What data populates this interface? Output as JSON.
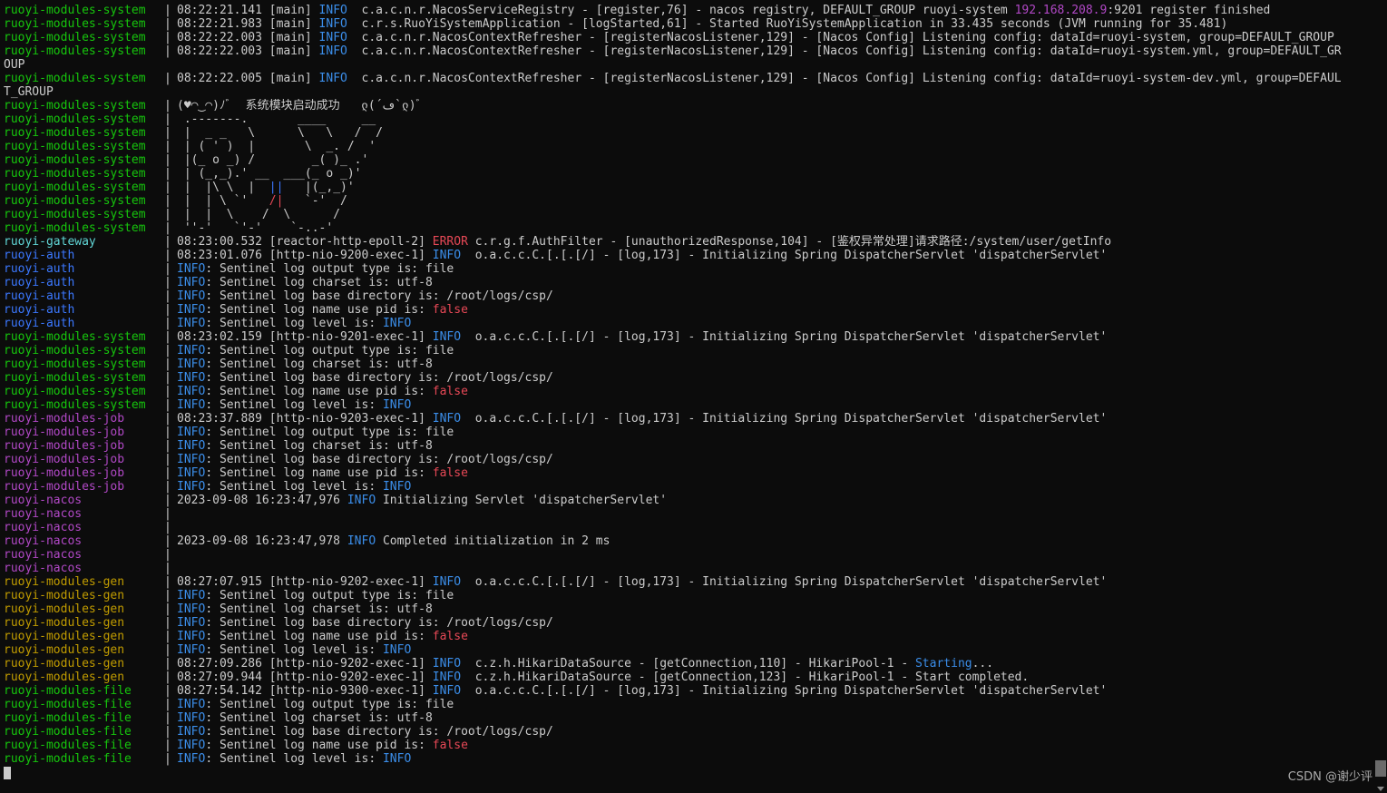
{
  "colors": {
    "background": "#0c0c0c",
    "foreground": "#cccccc",
    "info": "#3b8eea",
    "error": "#e74856",
    "system": "#16c60c",
    "gateway": "#61d6d6",
    "auth": "#3b78ff",
    "job": "#b148c6",
    "gen": "#c19c00",
    "file": "#16c60c"
  },
  "terminal": {
    "lines": [
      {
        "svc": "ruoyi-modules-system",
        "c": "c-system",
        "sep": "|",
        "segs": [
          {
            "t": "08:22:21.141 [main] "
          },
          {
            "t": "INFO",
            "c": "c-info"
          },
          {
            "t": "  c.a.c.n.r.NacosServiceRegistry - [register,76] - nacos registry, DEFAULT_GROUP ruoyi-system "
          },
          {
            "t": "192.168.208.9",
            "c": "c-ip"
          },
          {
            "t": ":9201 register finished"
          }
        ]
      },
      {
        "svc": "ruoyi-modules-system",
        "c": "c-system",
        "sep": "|",
        "segs": [
          {
            "t": "08:22:21.983 [main] "
          },
          {
            "t": "INFO",
            "c": "c-info"
          },
          {
            "t": "  c.r.s.RuoYiSystemApplication - [logStarted,61] - Started RuoYiSystemApplication in 33.435 seconds (JVM running for 35.481)"
          }
        ]
      },
      {
        "svc": "ruoyi-modules-system",
        "c": "c-system",
        "sep": "|",
        "segs": [
          {
            "t": "08:22:22.003 [main] "
          },
          {
            "t": "INFO",
            "c": "c-info"
          },
          {
            "t": "  c.a.c.n.r.NacosContextRefresher - [registerNacosListener,129] - [Nacos Config] Listening config: dataId=ruoyi-system, group=DEFAULT_GROUP"
          }
        ]
      },
      {
        "svc": "ruoyi-modules-system",
        "c": "c-system",
        "sep": "|",
        "segs": [
          {
            "t": "08:22:22.003 [main] "
          },
          {
            "t": "INFO",
            "c": "c-info"
          },
          {
            "t": "  c.a.c.n.r.NacosContextRefresher - [registerNacosListener,129] - [Nacos Config] Listening config: dataId=ruoyi-system.yml, group=DEFAULT_GR"
          }
        ]
      },
      {
        "svc": "",
        "c": "",
        "sep": "",
        "segs": [
          {
            "t": "OUP"
          }
        ]
      },
      {
        "svc": "ruoyi-modules-system",
        "c": "c-system",
        "sep": "|",
        "segs": [
          {
            "t": "08:22:22.005 [main] "
          },
          {
            "t": "INFO",
            "c": "c-info"
          },
          {
            "t": "  c.a.c.n.r.NacosContextRefresher - [registerNacosListener,129] - [Nacos Config] Listening config: dataId=ruoyi-system-dev.yml, group=DEFAUL"
          }
        ]
      },
      {
        "svc": "",
        "c": "",
        "sep": "",
        "segs": [
          {
            "t": "T_GROUP"
          }
        ]
      },
      {
        "svc": "ruoyi-modules-system",
        "c": "c-system",
        "sep": "|",
        "segs": [
          {
            "t": "(♥◠‿◠)ﾉﾞ  系统模块启动成功   ლ(´ڡ`ლ)ﾞ"
          }
        ]
      },
      {
        "svc": "ruoyi-modules-system",
        "c": "c-system",
        "sep": "|",
        "segs": [
          {
            "t": " .-------.       ____     __"
          }
        ]
      },
      {
        "svc": "ruoyi-modules-system",
        "c": "c-system",
        "sep": "|",
        "segs": [
          {
            "t": " |  _ _   \\      \\   \\   /  /"
          }
        ]
      },
      {
        "svc": "ruoyi-modules-system",
        "c": "c-system",
        "sep": "|",
        "segs": [
          {
            "t": " | ( ' )  |       \\  _. /  '"
          }
        ]
      },
      {
        "svc": "ruoyi-modules-system",
        "c": "c-system",
        "sep": "|",
        "segs": [
          {
            "t": " |(_ o _) /        _( )_ .'"
          }
        ]
      },
      {
        "svc": "ruoyi-modules-system",
        "c": "c-system",
        "sep": "|",
        "segs": [
          {
            "t": " | (_,_).' __  ___(_ o _)'"
          }
        ]
      },
      {
        "svc": "ruoyi-modules-system",
        "c": "c-system",
        "sep": "|",
        "segs": [
          {
            "t": " |  |\\ \\  |  "
          },
          {
            "t": "||",
            "c": "c-ascii-blue"
          },
          {
            "t": "   |(_,_)'"
          }
        ]
      },
      {
        "svc": "ruoyi-modules-system",
        "c": "c-system",
        "sep": "|",
        "segs": [
          {
            "t": " |  | \\ `'   "
          },
          {
            "t": "/|",
            "c": "c-ascii-red"
          },
          {
            "t": "   `-'  /"
          }
        ]
      },
      {
        "svc": "ruoyi-modules-system",
        "c": "c-system",
        "sep": "|",
        "segs": [
          {
            "t": " |  |  \\    /  \\      /"
          }
        ]
      },
      {
        "svc": "ruoyi-modules-system",
        "c": "c-system",
        "sep": "|",
        "segs": [
          {
            "t": " ''-'   `'-'    `-..-'"
          }
        ]
      },
      {
        "svc": "ruoyi-gateway",
        "c": "c-gateway",
        "sep": "|",
        "segs": [
          {
            "t": "08:23:00.532 [reactor-http-epoll-2] "
          },
          {
            "t": "ERROR",
            "c": "c-error"
          },
          {
            "t": " c.r.g.f.AuthFilter - [unauthorizedResponse,104] - [鉴权异常处理]请求路径:/system/user/getInfo"
          }
        ]
      },
      {
        "svc": "ruoyi-auth",
        "c": "c-auth",
        "sep": "|",
        "segs": [
          {
            "t": "08:23:01.076 [http-nio-9200-exec-1] "
          },
          {
            "t": "INFO",
            "c": "c-info"
          },
          {
            "t": "  o.a.c.c.C.[.[.[/] - [log,173] - Initializing Spring DispatcherServlet 'dispatcherServlet'"
          }
        ]
      },
      {
        "svc": "ruoyi-auth",
        "c": "c-auth",
        "sep": "|",
        "segs": [
          {
            "t": "INFO",
            "c": "c-info"
          },
          {
            "t": ": Sentinel log output type is: file"
          }
        ]
      },
      {
        "svc": "ruoyi-auth",
        "c": "c-auth",
        "sep": "|",
        "segs": [
          {
            "t": "INFO",
            "c": "c-info"
          },
          {
            "t": ": Sentinel log charset is: utf-8"
          }
        ]
      },
      {
        "svc": "ruoyi-auth",
        "c": "c-auth",
        "sep": "|",
        "segs": [
          {
            "t": "INFO",
            "c": "c-info"
          },
          {
            "t": ": Sentinel log base directory is: /root/logs/csp/"
          }
        ]
      },
      {
        "svc": "ruoyi-auth",
        "c": "c-auth",
        "sep": "|",
        "segs": [
          {
            "t": "INFO",
            "c": "c-info"
          },
          {
            "t": ": Sentinel log name use pid is: "
          },
          {
            "t": "false",
            "c": "c-false"
          }
        ]
      },
      {
        "svc": "ruoyi-auth",
        "c": "c-auth",
        "sep": "|",
        "segs": [
          {
            "t": "INFO",
            "c": "c-info"
          },
          {
            "t": ": Sentinel log level is: "
          },
          {
            "t": "INFO",
            "c": "c-info"
          }
        ]
      },
      {
        "svc": "ruoyi-modules-system",
        "c": "c-system",
        "sep": "|",
        "segs": [
          {
            "t": "08:23:02.159 [http-nio-9201-exec-1] "
          },
          {
            "t": "INFO",
            "c": "c-info"
          },
          {
            "t": "  o.a.c.c.C.[.[.[/] - [log,173] - Initializing Spring DispatcherServlet 'dispatcherServlet'"
          }
        ]
      },
      {
        "svc": "ruoyi-modules-system",
        "c": "c-system",
        "sep": "|",
        "segs": [
          {
            "t": "INFO",
            "c": "c-info"
          },
          {
            "t": ": Sentinel log output type is: file"
          }
        ]
      },
      {
        "svc": "ruoyi-modules-system",
        "c": "c-system",
        "sep": "|",
        "segs": [
          {
            "t": "INFO",
            "c": "c-info"
          },
          {
            "t": ": Sentinel log charset is: utf-8"
          }
        ]
      },
      {
        "svc": "ruoyi-modules-system",
        "c": "c-system",
        "sep": "|",
        "segs": [
          {
            "t": "INFO",
            "c": "c-info"
          },
          {
            "t": ": Sentinel log base directory is: /root/logs/csp/"
          }
        ]
      },
      {
        "svc": "ruoyi-modules-system",
        "c": "c-system",
        "sep": "|",
        "segs": [
          {
            "t": "INFO",
            "c": "c-info"
          },
          {
            "t": ": Sentinel log name use pid is: "
          },
          {
            "t": "false",
            "c": "c-false"
          }
        ]
      },
      {
        "svc": "ruoyi-modules-system",
        "c": "c-system",
        "sep": "|",
        "segs": [
          {
            "t": "INFO",
            "c": "c-info"
          },
          {
            "t": ": Sentinel log level is: "
          },
          {
            "t": "INFO",
            "c": "c-info"
          }
        ]
      },
      {
        "svc": "ruoyi-modules-job",
        "c": "c-job",
        "sep": "|",
        "segs": [
          {
            "t": "08:23:37.889 [http-nio-9203-exec-1] "
          },
          {
            "t": "INFO",
            "c": "c-info"
          },
          {
            "t": "  o.a.c.c.C.[.[.[/] - [log,173] - Initializing Spring DispatcherServlet 'dispatcherServlet'"
          }
        ]
      },
      {
        "svc": "ruoyi-modules-job",
        "c": "c-job",
        "sep": "|",
        "segs": [
          {
            "t": "INFO",
            "c": "c-info"
          },
          {
            "t": ": Sentinel log output type is: file"
          }
        ]
      },
      {
        "svc": "ruoyi-modules-job",
        "c": "c-job",
        "sep": "|",
        "segs": [
          {
            "t": "INFO",
            "c": "c-info"
          },
          {
            "t": ": Sentinel log charset is: utf-8"
          }
        ]
      },
      {
        "svc": "ruoyi-modules-job",
        "c": "c-job",
        "sep": "|",
        "segs": [
          {
            "t": "INFO",
            "c": "c-info"
          },
          {
            "t": ": Sentinel log base directory is: /root/logs/csp/"
          }
        ]
      },
      {
        "svc": "ruoyi-modules-job",
        "c": "c-job",
        "sep": "|",
        "segs": [
          {
            "t": "INFO",
            "c": "c-info"
          },
          {
            "t": ": Sentinel log name use pid is: "
          },
          {
            "t": "false",
            "c": "c-false"
          }
        ]
      },
      {
        "svc": "ruoyi-modules-job",
        "c": "c-job",
        "sep": "|",
        "segs": [
          {
            "t": "INFO",
            "c": "c-info"
          },
          {
            "t": ": Sentinel log level is: "
          },
          {
            "t": "INFO",
            "c": "c-info"
          }
        ]
      },
      {
        "svc": "ruoyi-nacos",
        "c": "c-nacos",
        "sep": "|",
        "segs": [
          {
            "t": "2023-09-08 16:23:47,976 "
          },
          {
            "t": "INFO",
            "c": "c-info"
          },
          {
            "t": " Initializing Servlet 'dispatcherServlet'"
          }
        ]
      },
      {
        "svc": "ruoyi-nacos",
        "c": "c-nacos",
        "sep": "|",
        "segs": []
      },
      {
        "svc": "ruoyi-nacos",
        "c": "c-nacos",
        "sep": "|",
        "segs": []
      },
      {
        "svc": "ruoyi-nacos",
        "c": "c-nacos",
        "sep": "|",
        "segs": [
          {
            "t": "2023-09-08 16:23:47,978 "
          },
          {
            "t": "INFO",
            "c": "c-info"
          },
          {
            "t": " Completed initialization in 2 ms"
          }
        ]
      },
      {
        "svc": "ruoyi-nacos",
        "c": "c-nacos",
        "sep": "|",
        "segs": []
      },
      {
        "svc": "ruoyi-nacos",
        "c": "c-nacos",
        "sep": "|",
        "segs": []
      },
      {
        "svc": "ruoyi-modules-gen",
        "c": "c-gen",
        "sep": "|",
        "segs": [
          {
            "t": "08:27:07.915 [http-nio-9202-exec-1] "
          },
          {
            "t": "INFO",
            "c": "c-info"
          },
          {
            "t": "  o.a.c.c.C.[.[.[/] - [log,173] - Initializing Spring DispatcherServlet 'dispatcherServlet'"
          }
        ]
      },
      {
        "svc": "ruoyi-modules-gen",
        "c": "c-gen",
        "sep": "|",
        "segs": [
          {
            "t": "INFO",
            "c": "c-info"
          },
          {
            "t": ": Sentinel log output type is: file"
          }
        ]
      },
      {
        "svc": "ruoyi-modules-gen",
        "c": "c-gen",
        "sep": "|",
        "segs": [
          {
            "t": "INFO",
            "c": "c-info"
          },
          {
            "t": ": Sentinel log charset is: utf-8"
          }
        ]
      },
      {
        "svc": "ruoyi-modules-gen",
        "c": "c-gen",
        "sep": "|",
        "segs": [
          {
            "t": "INFO",
            "c": "c-info"
          },
          {
            "t": ": Sentinel log base directory is: /root/logs/csp/"
          }
        ]
      },
      {
        "svc": "ruoyi-modules-gen",
        "c": "c-gen",
        "sep": "|",
        "segs": [
          {
            "t": "INFO",
            "c": "c-info"
          },
          {
            "t": ": Sentinel log name use pid is: "
          },
          {
            "t": "false",
            "c": "c-false"
          }
        ]
      },
      {
        "svc": "ruoyi-modules-gen",
        "c": "c-gen",
        "sep": "|",
        "segs": [
          {
            "t": "INFO",
            "c": "c-info"
          },
          {
            "t": ": Sentinel log level is: "
          },
          {
            "t": "INFO",
            "c": "c-info"
          }
        ]
      },
      {
        "svc": "ruoyi-modules-gen",
        "c": "c-gen",
        "sep": "|",
        "segs": [
          {
            "t": "08:27:09.286 [http-nio-9202-exec-1] "
          },
          {
            "t": "INFO",
            "c": "c-info"
          },
          {
            "t": "  c.z.h.HikariDataSource - [getConnection,110] - HikariPool-1 - "
          },
          {
            "t": "Starting",
            "c": "c-starting"
          },
          {
            "t": "..."
          }
        ]
      },
      {
        "svc": "ruoyi-modules-gen",
        "c": "c-gen",
        "sep": "|",
        "segs": [
          {
            "t": "08:27:09.944 [http-nio-9202-exec-1] "
          },
          {
            "t": "INFO",
            "c": "c-info"
          },
          {
            "t": "  c.z.h.HikariDataSource - [getConnection,123] - HikariPool-1 - Start completed."
          }
        ]
      },
      {
        "svc": "ruoyi-modules-file",
        "c": "c-file",
        "sep": "|",
        "segs": [
          {
            "t": "08:27:54.142 [http-nio-9300-exec-1] "
          },
          {
            "t": "INFO",
            "c": "c-info"
          },
          {
            "t": "  o.a.c.c.C.[.[.[/] - [log,173] - Initializing Spring DispatcherServlet 'dispatcherServlet'"
          }
        ]
      },
      {
        "svc": "ruoyi-modules-file",
        "c": "c-file",
        "sep": "|",
        "segs": [
          {
            "t": "INFO",
            "c": "c-info"
          },
          {
            "t": ": Sentinel log output type is: file"
          }
        ]
      },
      {
        "svc": "ruoyi-modules-file",
        "c": "c-file",
        "sep": "|",
        "segs": [
          {
            "t": "INFO",
            "c": "c-info"
          },
          {
            "t": ": Sentinel log charset is: utf-8"
          }
        ]
      },
      {
        "svc": "ruoyi-modules-file",
        "c": "c-file",
        "sep": "|",
        "segs": [
          {
            "t": "INFO",
            "c": "c-info"
          },
          {
            "t": ": Sentinel log base directory is: /root/logs/csp/"
          }
        ]
      },
      {
        "svc": "ruoyi-modules-file",
        "c": "c-file",
        "sep": "|",
        "segs": [
          {
            "t": "INFO",
            "c": "c-info"
          },
          {
            "t": ": Sentinel log name use pid is: "
          },
          {
            "t": "false",
            "c": "c-false"
          }
        ]
      },
      {
        "svc": "ruoyi-modules-file",
        "c": "c-file",
        "sep": "|",
        "segs": [
          {
            "t": "INFO",
            "c": "c-info"
          },
          {
            "t": ": Sentinel log level is: "
          },
          {
            "t": "INFO",
            "c": "c-info"
          }
        ]
      }
    ]
  },
  "watermark": {
    "text": "CSDN @谢少评"
  }
}
